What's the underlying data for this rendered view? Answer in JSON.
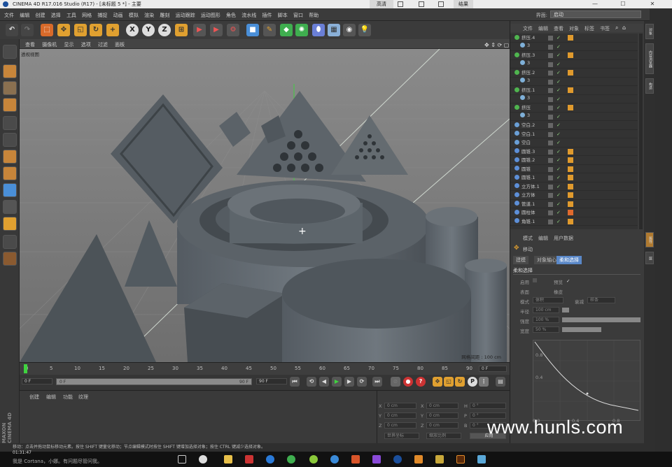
{
  "window": {
    "title": "CINEMA 4D R17.016 Studio (R17) - [未标题 5 *] - 主要",
    "controls": [
      "高清",
      "结果"
    ]
  },
  "menu": [
    "文件",
    "编辑",
    "创建",
    "选择",
    "工具",
    "网格",
    "捕捉",
    "动画",
    "模拟",
    "渲染",
    "雕刻",
    "运动跟踪",
    "运动图形",
    "角色",
    "流水线",
    "插件",
    "脚本",
    "窗口",
    "帮助"
  ],
  "layout": {
    "label": "界面:",
    "value": "启动"
  },
  "toolbar_icons": [
    "undo-icon",
    "select-icon",
    "move-icon",
    "scale-icon",
    "rotate-icon",
    "add-icon",
    "x-axis",
    "y-axis",
    "z-axis",
    "coord-icon",
    "render-view-icon",
    "render-icon",
    "render-settings-icon",
    "cube-icon",
    "pen-icon",
    "subdivide-icon",
    "array-icon",
    "deformer-icon",
    "floor-icon",
    "camera-icon",
    "light-icon"
  ],
  "axes": {
    "x": "X",
    "y": "Y",
    "z": "Z"
  },
  "viewport": {
    "menu": [
      "查看",
      "摄像机",
      "显示",
      "选项",
      "过滤",
      "面板"
    ],
    "label": "透视视图",
    "grid_info": "网格间距 : 100 cm"
  },
  "timeline": {
    "ticks": [
      "0",
      "5",
      "10",
      "15",
      "20",
      "25",
      "30",
      "35",
      "40",
      "45",
      "50",
      "55",
      "60",
      "65",
      "70",
      "75",
      "80",
      "85",
      "90"
    ],
    "frame": "0 F"
  },
  "transport": {
    "start": "0 F",
    "slider_left": "0 F",
    "slider_right": "90 F",
    "end": "90 F"
  },
  "material": {
    "menu": [
      "创建",
      "编辑",
      "功能",
      "纹理"
    ]
  },
  "coords": {
    "rows": [
      {
        "a": "X",
        "av": "0 cm",
        "b": "X",
        "bv": "0 cm",
        "c": "H",
        "cv": "0 °"
      },
      {
        "a": "Y",
        "av": "0 cm",
        "b": "Y",
        "bv": "0 cm",
        "c": "P",
        "cv": "0 °"
      },
      {
        "a": "Z",
        "av": "0 cm",
        "b": "Z",
        "bv": "0 cm",
        "c": "B",
        "cv": "0 °"
      }
    ],
    "mode1": "世界坐标",
    "mode2": "缩放比例",
    "apply": "应用"
  },
  "objects": {
    "menu": [
      "文件",
      "编辑",
      "查看",
      "对象",
      "标签",
      "书签"
    ],
    "rows": [
      {
        "name": "挤压.4",
        "color": "#4fb54f",
        "tag": "#e09a2d"
      },
      {
        "name": "3",
        "color": "#7fb0d8",
        "tag": ""
      },
      {
        "name": "挤压.3",
        "color": "#4fb54f",
        "tag": "#e09a2d"
      },
      {
        "name": "3",
        "color": "#7fb0d8",
        "tag": ""
      },
      {
        "name": "挤压.2",
        "color": "#4fb54f",
        "tag": "#e09a2d"
      },
      {
        "name": "3",
        "color": "#7fb0d8",
        "tag": ""
      },
      {
        "name": "挤压.1",
        "color": "#4fb54f",
        "tag": "#e09a2d"
      },
      {
        "name": "3",
        "color": "#7fb0d8",
        "tag": ""
      },
      {
        "name": "挤压",
        "color": "#4fb54f",
        "tag": "#e09a2d"
      },
      {
        "name": "3",
        "color": "#7fb0d8",
        "tag": ""
      },
      {
        "name": "空白.2",
        "color": "#6a9fd6",
        "tag": ""
      },
      {
        "name": "空白.1",
        "color": "#6a9fd6",
        "tag": ""
      },
      {
        "name": "空白",
        "color": "#6a9fd6",
        "tag": ""
      },
      {
        "name": "圆锥.3",
        "color": "#5d8fd8",
        "tag": "#e09a2d"
      },
      {
        "name": "圆锥.2",
        "color": "#5d8fd8",
        "tag": "#e09a2d"
      },
      {
        "name": "圆锥",
        "color": "#5d8fd8",
        "tag": "#e09a2d"
      },
      {
        "name": "圆锥.1",
        "color": "#5d8fd8",
        "tag": "#e09a2d"
      },
      {
        "name": "立方体.1",
        "color": "#5d8fd8",
        "tag": "#e09a2d"
      },
      {
        "name": "立方体",
        "color": "#5d8fd8",
        "tag": "#e09a2d"
      },
      {
        "name": "管道.1",
        "color": "#5d8fd8",
        "tag": "#e09a2d"
      },
      {
        "name": "圆柱体",
        "color": "#5d8fd8",
        "tag": "#e06a2d"
      },
      {
        "name": "角锥.1",
        "color": "#5d8fd8",
        "tag": "#e09a2d"
      }
    ]
  },
  "attributes": {
    "menu": [
      "模式",
      "编辑",
      "用户数据"
    ],
    "tool": "移动",
    "tabs": [
      "建模",
      "对象轴心",
      "柔和选择"
    ],
    "section": "柔和选择",
    "fields": [
      {
        "label": "启用",
        "value": ""
      },
      {
        "label": "预览",
        "value": "✓"
      },
      {
        "label": "表面",
        "value": ""
      },
      {
        "label": "橡皮",
        "value": ""
      },
      {
        "label": "限制",
        "value": ""
      },
      {
        "label": "模式",
        "value": "体积"
      },
      {
        "label": "衰减",
        "value": "样条"
      },
      {
        "label": "半径",
        "value": "100 cm"
      },
      {
        "label": "强度",
        "value": "100 %"
      },
      {
        "label": "宽度",
        "value": "50 %"
      }
    ],
    "graph": {
      "yticks": [
        "0.8",
        "0.4"
      ],
      "xticks": [
        "0.0",
        "0.4",
        "0.8"
      ]
    }
  },
  "side_tabs": [
    "对象",
    "内容浏览器",
    "构造",
    "属性",
    "层"
  ],
  "status": "移动：点击并拖动鼠标移动元素。按住 SHIFT 键量化移动；节点编辑模式时按住 SHIFT 键增加选择对象；按住 CTRL 键减少选择对象。",
  "taskbar": {
    "time": "01:31:47",
    "search": "我是 Cortana，小娜。有问题尽管问我。"
  },
  "watermark": "www.hunls.com",
  "maxon": "MAXON CINEMA 4D"
}
